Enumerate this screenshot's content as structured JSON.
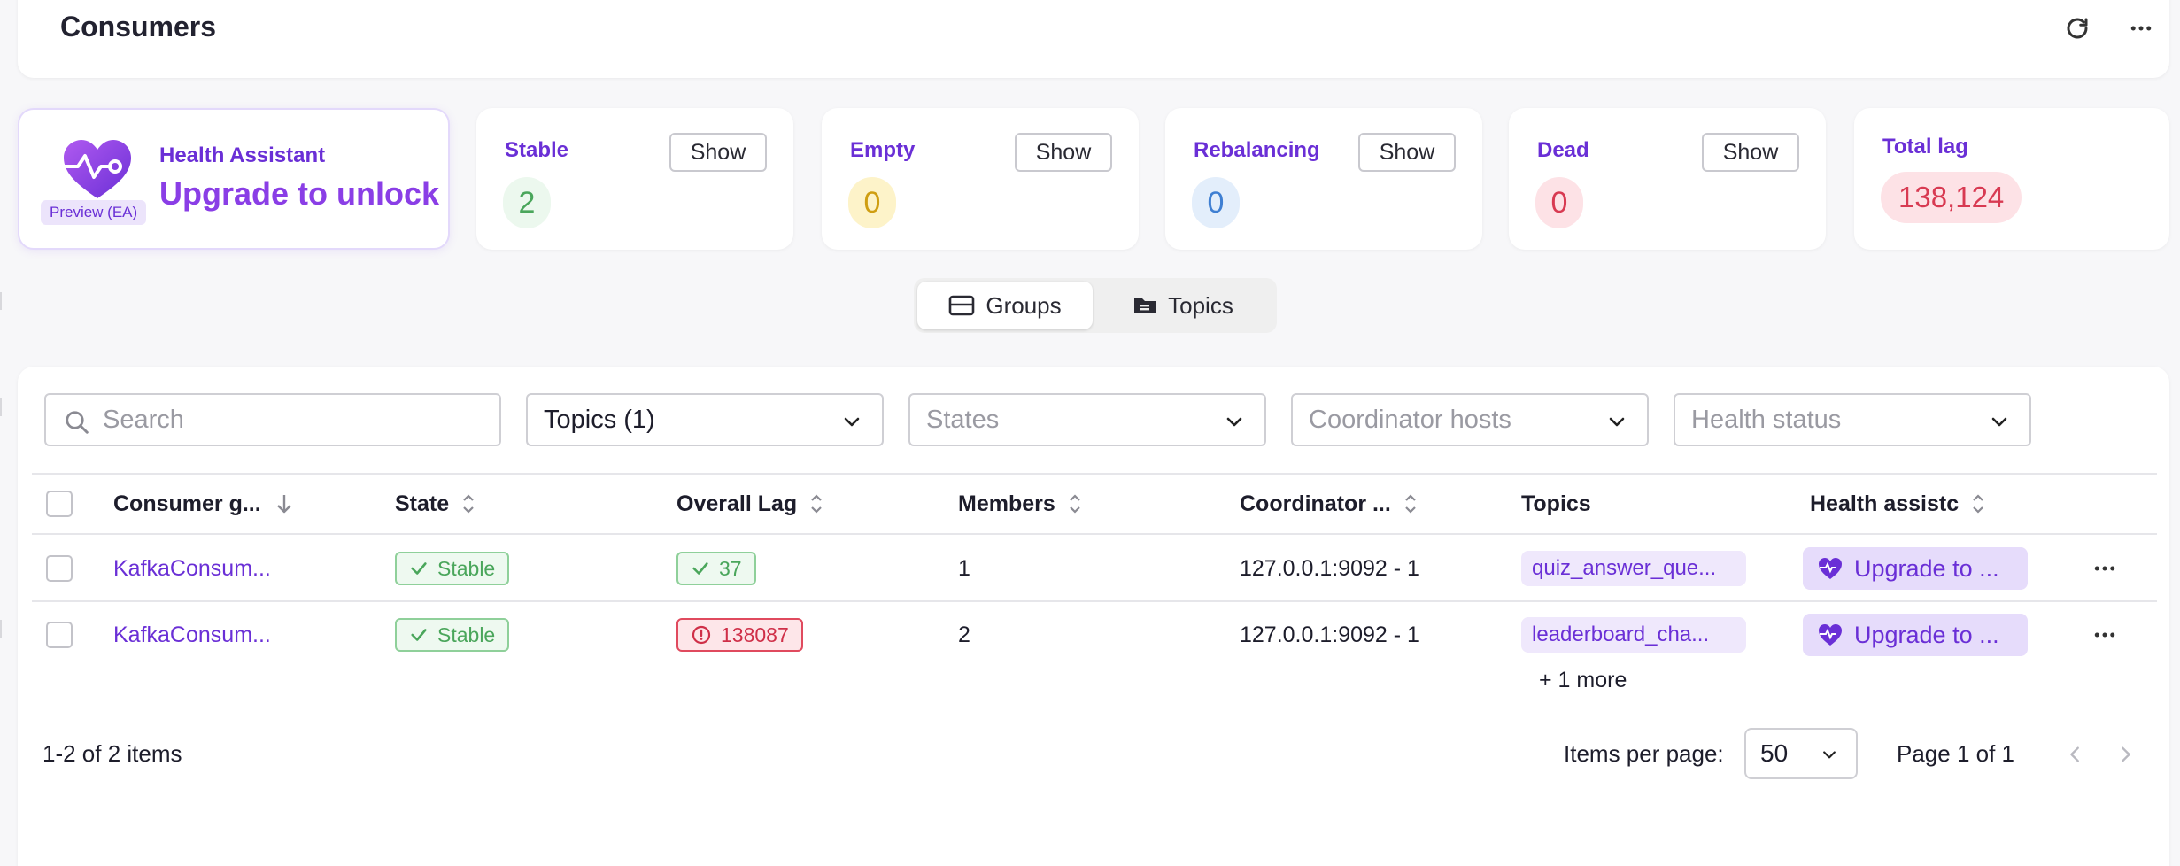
{
  "header": {
    "title": "Consumers",
    "refresh_icon": "refresh-icon",
    "more_icon": "more-horizontal-icon"
  },
  "health_card": {
    "title": "Health Assistant",
    "cta": "Upgrade to unlock",
    "tag": "Preview (EA)"
  },
  "stats": [
    {
      "label": "Stable",
      "value": "2",
      "button": "Show",
      "color": "#4aa65b"
    },
    {
      "label": "Empty",
      "value": "0",
      "button": "Show",
      "color": "#cf9e12"
    },
    {
      "label": "Rebalancing",
      "value": "0",
      "button": "Show",
      "color": "#3f7fd2"
    },
    {
      "label": "Dead",
      "value": "0",
      "button": "Show",
      "color": "#d83a52"
    },
    {
      "label": "Total lag",
      "value": "138,124",
      "color": "#d83a52"
    }
  ],
  "view_toggle": {
    "groups": "Groups",
    "topics": "Topics",
    "active": "Groups"
  },
  "filters": {
    "search_placeholder": "Search",
    "topics": "Topics (1)",
    "states": "States",
    "coordinator_hosts": "Coordinator hosts",
    "health_status": "Health status"
  },
  "table": {
    "columns": [
      "Consumer g...",
      "State",
      "Overall Lag",
      "Members",
      "Coordinator ...",
      "Topics",
      "Health assistc"
    ],
    "rows": [
      {
        "group": "KafkaConsum...",
        "state": "Stable",
        "lag": "37",
        "lag_status": "ok",
        "members": "1",
        "coordinator": "127.0.0.1:9092 - 1",
        "topic": "quiz_answer_que...",
        "extra_topics": "",
        "health": "Upgrade to ..."
      },
      {
        "group": "KafkaConsum...",
        "state": "Stable",
        "lag": "138087",
        "lag_status": "error",
        "members": "2",
        "coordinator": "127.0.0.1:9092 - 1",
        "topic": "leaderboard_cha...",
        "extra_topics": "+ 1 more",
        "health": "Upgrade to ..."
      }
    ]
  },
  "pagination": {
    "summary": "1-2 of 2 items",
    "per_page_label": "Items per page:",
    "per_page_value": "50",
    "page_label": "Page 1 of 1"
  },
  "colors": {
    "accent": "#6a2fd6",
    "accent_light": "#efe8fc",
    "ok": "#4aa65b",
    "error": "#d83a52"
  }
}
